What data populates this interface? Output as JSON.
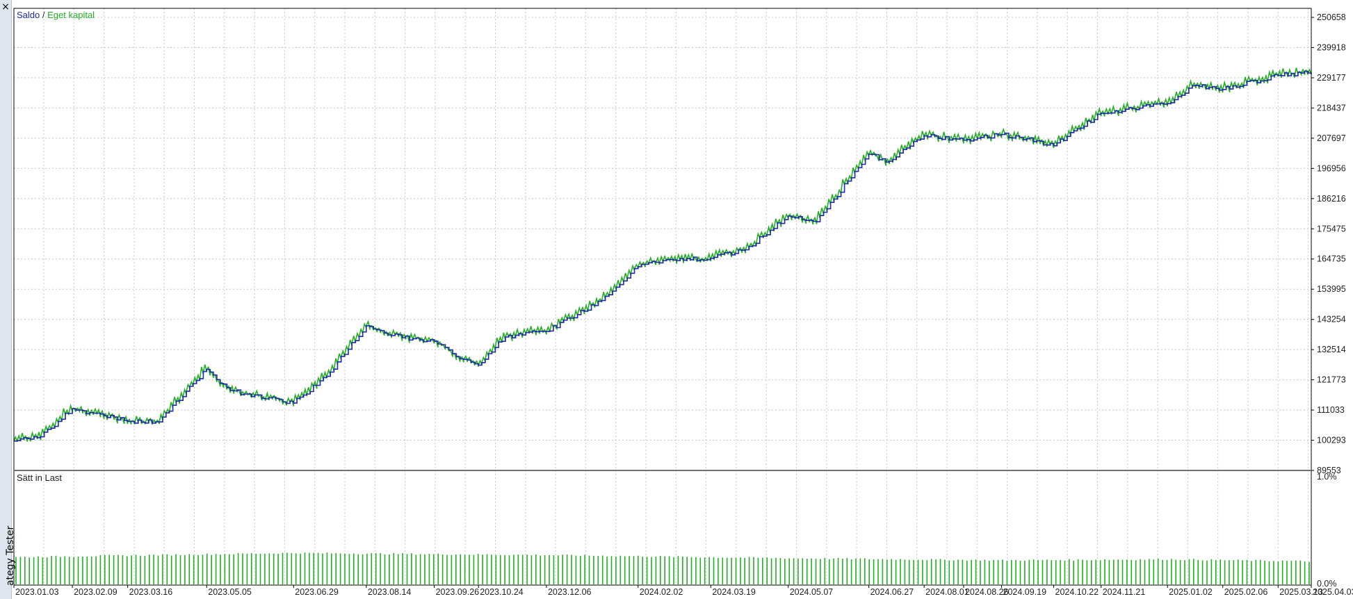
{
  "window": {
    "close_label": "×",
    "side_panel_label": "ategy Tester"
  },
  "top_panel": {
    "legend": {
      "balance_label": "Saldo",
      "separator": "/",
      "equity_label": "Eget kapital"
    }
  },
  "bottom_panel": {
    "title": "Sätt in Last"
  },
  "colors": {
    "balance": "#1f2aa8",
    "equity": "#22b022",
    "grid": "#c8c8c8",
    "border": "#000000",
    "divider": "#707070",
    "load_bars": "#22b022"
  },
  "chart_data": [
    {
      "type": "line",
      "series": [
        {
          "name": "Saldo",
          "color": "#1f2aa8"
        },
        {
          "name": "Eget kapital",
          "color": "#22b022"
        }
      ],
      "x": [
        "2023.01.03",
        "2023.01.20",
        "2023.02.09",
        "2023.03.01",
        "2023.03.16",
        "2023.04.05",
        "2023.05.05",
        "2023.05.20",
        "2023.06.29",
        "2023.07.20",
        "2023.08.14",
        "2023.08.30",
        "2023.09.26",
        "2023.10.10",
        "2023.10.24",
        "2023.11.10",
        "2023.12.06",
        "2024.01.10",
        "2024.02.02",
        "2024.02.20",
        "2024.03.19",
        "2024.04.10",
        "2024.05.07",
        "2024.05.25",
        "2024.06.27",
        "2024.07.10",
        "2024.08.01",
        "2024.08.26",
        "2024.09.19",
        "2024.10.05",
        "2024.10.22",
        "2024.11.21",
        "2025.01.02",
        "2025.01.20",
        "2025.02.06",
        "2025.03.13",
        "2025.04.03"
      ],
      "y": [
        100000,
        101500,
        111500,
        109000,
        107000,
        106800,
        125500,
        118000,
        113500,
        123000,
        141000,
        137500,
        135500,
        130000,
        127000,
        137000,
        139000,
        150000,
        162000,
        164500,
        165000,
        168000,
        180000,
        178000,
        202000,
        199500,
        208500,
        207000,
        209000,
        207500,
        205000,
        216500,
        220000,
        226500,
        225000,
        230000,
        231000
      ],
      "equity_spread": 1800,
      "x_ticks": [
        "2023.01.03",
        "2023.02.09",
        "2023.03.16",
        "2023.05.05",
        "2023.06.29",
        "2023.08.14",
        "2023.09.26",
        "2023.10.24",
        "2023.12.06",
        "2024.02.02",
        "2024.03.19",
        "2024.05.07",
        "2024.06.27",
        "2024.08.01",
        "2024.08.26",
        "2024.09.19",
        "2024.10.22",
        "2024.11.21",
        "2025.01.02",
        "2025.02.06",
        "2025.03.13",
        "2025.04.03"
      ],
      "y_ticks": [
        "250658",
        "239918",
        "229177",
        "218437",
        "207697",
        "196956",
        "186216",
        "175475",
        "164735",
        "153995",
        "143254",
        "132514",
        "121773",
        "111033",
        "100293",
        "89553"
      ],
      "ylim": [
        89553,
        250658
      ],
      "grid": true,
      "legend_position": "top-left"
    },
    {
      "type": "bar",
      "name": "Sätt in Last",
      "y_ticks": [
        "1.0%",
        "0.0%"
      ],
      "ylim": [
        0,
        1
      ],
      "bar_count": 292,
      "profile_x": [
        "2023.01.03",
        "2023.06.29",
        "2023.12.06",
        "2024.05.07",
        "2024.09.19",
        "2025.01.02",
        "2025.04.03"
      ],
      "profile_values": [
        0.26,
        0.3,
        0.28,
        0.25,
        0.23,
        0.24,
        0.22
      ]
    }
  ]
}
